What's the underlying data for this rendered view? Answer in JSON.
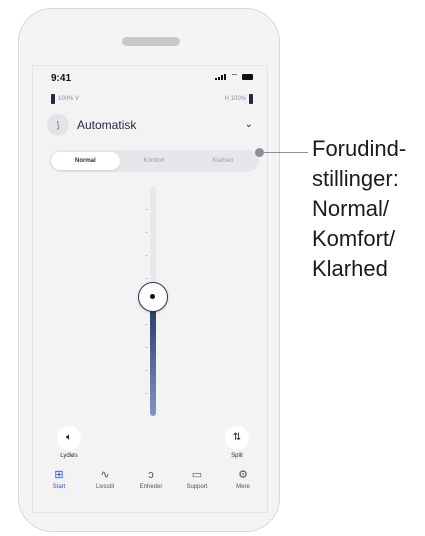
{
  "status_bar": {
    "time": "9:41"
  },
  "batteries": {
    "left_text": "100% V",
    "right_text": "H 100%"
  },
  "program": {
    "label": "Automatisk",
    "icon": "hearing-program-icon"
  },
  "presets": {
    "options": [
      "Normal",
      "Komfort",
      "Klarhed"
    ],
    "selected": "Normal"
  },
  "volume_slider": {
    "level": 0.52
  },
  "actions": {
    "mute": {
      "label": "Lydløs",
      "icon": "speaker-mute-icon"
    },
    "split": {
      "label": "Split",
      "icon": "split-arrows-icon"
    }
  },
  "tabs": [
    {
      "label": "Start",
      "icon": "grid-icon",
      "active": true
    },
    {
      "label": "Livsstil",
      "icon": "pulse-icon",
      "active": false
    },
    {
      "label": "Enheder",
      "icon": "hearing-aid-icon",
      "active": false
    },
    {
      "label": "Support",
      "icon": "chat-bubble-icon",
      "active": false
    },
    {
      "label": "Mere",
      "icon": "gear-icon",
      "active": false
    }
  ],
  "callout": {
    "text": "Forudind-\nstillinger:\nNormal/\nKomfort/\nKlarhed"
  },
  "colors": {
    "accent": "#2557d6",
    "slider_dark": "#1f3560",
    "slider_light": "#8295c2"
  }
}
